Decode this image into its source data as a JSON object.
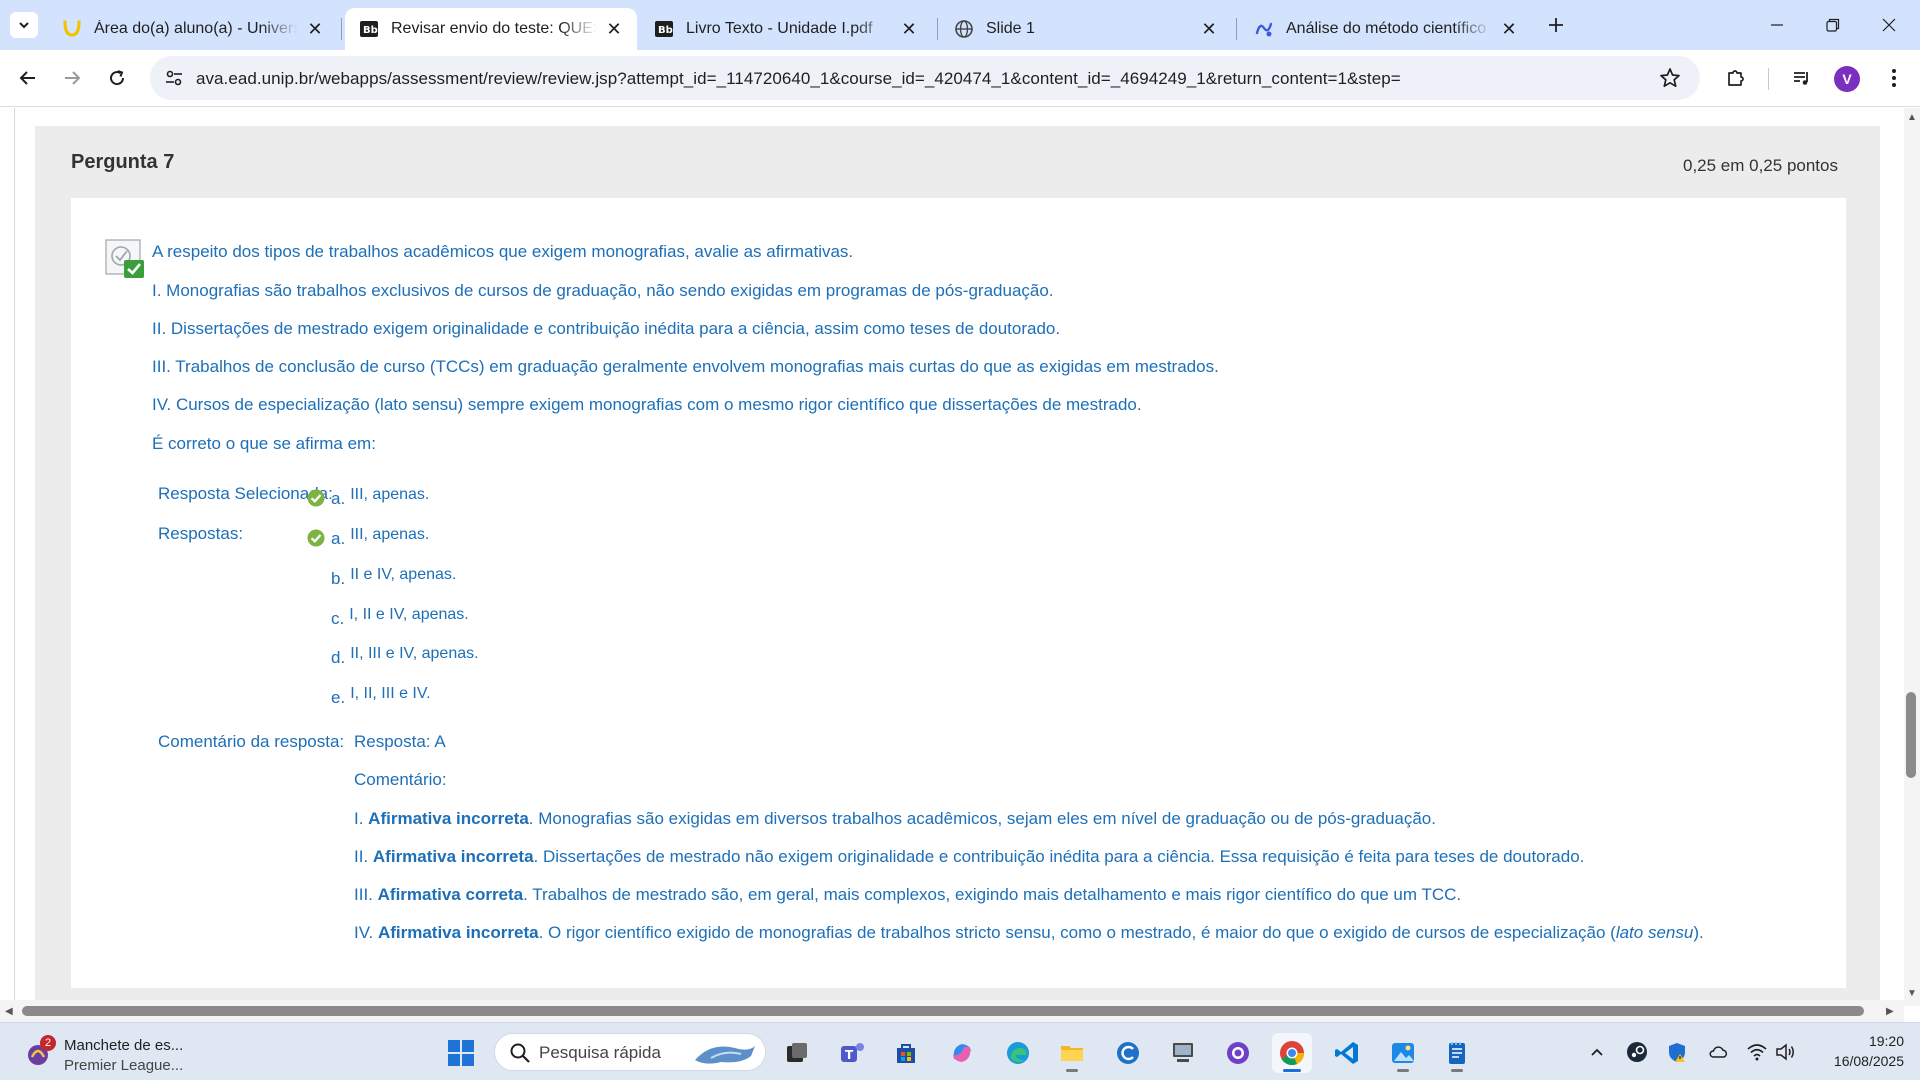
{
  "browser": {
    "tabs": [
      {
        "title": "Área do(a) aluno(a) - Universidade",
        "favicon": "unip-logo-icon",
        "active": false
      },
      {
        "title": "Revisar envio do teste: QUESTIONÁRIO",
        "favicon": "blackboard-icon",
        "active": true
      },
      {
        "title": "Livro Texto - Unidade I.pdf",
        "favicon": "blackboard-icon",
        "active": false
      },
      {
        "title": "Slide 1",
        "favicon": "globe-icon",
        "active": false
      },
      {
        "title": "Análise do método científico e",
        "favicon": "ai-assistant-icon",
        "active": false
      }
    ],
    "url": "ava.ead.unip.br/webapps/assessment/review/review.jsp?attempt_id=_114720640_1&course_id=_420474_1&content_id=_4694249_1&return_content=1&step=",
    "profile_initial": "V",
    "profile_color": "#7b2fbf"
  },
  "question": {
    "title": "Pergunta 7",
    "points": "0,25 em 0,25 pontos",
    "lines": [
      "A respeito dos tipos de trabalhos acadêmicos que exigem monografias, avalie as afirmativas.",
      "I. Monografias são trabalhos exclusivos de cursos de graduação, não sendo exigidas em programas de pós-graduação.",
      "II. Dissertações de mestrado exigem originalidade e contribuição inédita para a ciência, assim como teses de doutorado.",
      "III. Trabalhos de conclusão de curso (TCCs) em graduação geralmente envolvem monografias mais curtas do que as exigidas em mestrados.",
      "IV. Cursos de especialização (lato sensu) sempre exigem monografias com o mesmo rigor científico que dissertações de mestrado.",
      "É correto o que se afirma em:"
    ],
    "selected_label": "Resposta Selecionada:",
    "selected": {
      "letter": "a.",
      "text": "III, apenas."
    },
    "answers_label": "Respostas:",
    "answers": [
      {
        "letter": "a.",
        "text": "III, apenas.",
        "correct": true
      },
      {
        "letter": "b.",
        "text": "II e IV, apenas.",
        "correct": false
      },
      {
        "letter": "c.",
        "text": "I, II e IV, apenas.",
        "correct": false
      },
      {
        "letter": "d.",
        "text": "II, III e IV, apenas.",
        "correct": false
      },
      {
        "letter": "e.",
        "text": "I, II, III e IV.",
        "correct": false
      }
    ],
    "feedback_label": "Comentário da resposta:",
    "feedback_answer": "Resposta: A",
    "feedback_comment_label": "Comentário:",
    "feedback_items": [
      {
        "prefix": "I. ",
        "verdict": "Afirmativa incorreta",
        "text": ". Monografias são exigidas em diversos trabalhos acadêmicos, sejam eles em nível de graduação ou de pós-graduação.",
        "emph": "",
        "tail": ""
      },
      {
        "prefix": "II. ",
        "verdict": "Afirmativa incorreta",
        "text": ". Dissertações de mestrado não exigem originalidade e contribuição inédita para a ciência. Essa requisição é feita para teses de doutorado.",
        "emph": "",
        "tail": ""
      },
      {
        "prefix": "III. ",
        "verdict": "Afirmativa correta",
        "text": ". Trabalhos de mestrado são, em geral, mais complexos, exigindo mais detalhamento e mais rigor científico do que um TCC.",
        "emph": "",
        "tail": ""
      },
      {
        "prefix": "IV. ",
        "verdict": "Afirmativa incorreta",
        "text": ". O rigor científico exigido de monografias de trabalhos stricto sensu, como o mestrado, é maior do que o exigido de cursos de especialização (",
        "emph": "lato sensu",
        "tail": ")."
      }
    ]
  },
  "taskbar": {
    "news_badge": "2",
    "news_line1": "Manchete de es...",
    "news_line2": "Premier League...",
    "search_placeholder": "Pesquisa rápida",
    "time": "19:20",
    "date": "16/08/2025"
  },
  "colors": {
    "link_blue": "#1d6fb8",
    "tab_bar": "#d3e3fd",
    "correct_green": "#7cb342"
  }
}
